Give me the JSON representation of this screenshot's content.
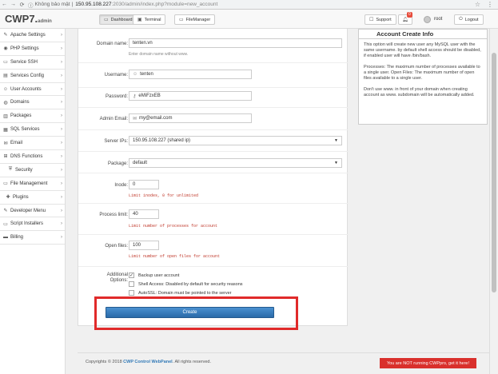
{
  "browser": {
    "secure_label": "Không bảo mật",
    "url_host": "150.95.108.227",
    "url_path": ":2030/admin/index.php?module=new_account"
  },
  "header": {
    "logo": "CWP7.",
    "logo_sub": "admin",
    "tabs": [
      {
        "label": "Dashboard",
        "icon": "monitor-icon"
      },
      {
        "label": "Terminal",
        "icon": "terminal-icon"
      },
      {
        "label": "FileManager",
        "icon": "folder-icon"
      }
    ],
    "support": "Support",
    "notifications": "0",
    "user": "root",
    "logout": "Logout"
  },
  "sidebar": {
    "items": [
      {
        "label": "Apache Settings",
        "icon": "wrench-icon"
      },
      {
        "label": "PHP Settings",
        "icon": "php-icon"
      },
      {
        "label": "Service SSH",
        "icon": "terminal-icon"
      },
      {
        "label": "Services Config",
        "icon": "server-icon"
      },
      {
        "label": "User Accounts",
        "icon": "user-icon"
      },
      {
        "label": "Domains",
        "icon": "globe-icon"
      },
      {
        "label": "Packages",
        "icon": "package-icon"
      },
      {
        "label": "SQL Services",
        "icon": "database-icon"
      },
      {
        "label": "Email",
        "icon": "envelope-icon"
      },
      {
        "label": "DNS Functions",
        "icon": "sitemap-icon"
      },
      {
        "label": "Security",
        "icon": "shield-icon"
      },
      {
        "label": "File Management",
        "icon": "folder-icon"
      },
      {
        "label": "Plugins",
        "icon": "puzzle-icon"
      },
      {
        "label": "Developer Menu",
        "icon": "code-icon"
      },
      {
        "label": "Script Installers",
        "icon": "download-icon"
      },
      {
        "label": "Billing",
        "icon": "credit-card-icon"
      }
    ]
  },
  "form": {
    "domain_label": "Domain name:",
    "domain_value": "tenten.vn",
    "domain_hint": "Enter domain name without www.",
    "username_label": "Username:",
    "username_value": "tenten",
    "password_label": "Password:",
    "password_value": "eMiFzxEB",
    "email_label": "Admin Email:",
    "email_value": "my@email.com",
    "ip_label": "Server IPs:",
    "ip_value": "150.95.108.227 (shared ip)",
    "package_label": "Package:",
    "package_value": "default",
    "inode_label": "Inode:",
    "inode_value": "0",
    "inode_hint": "Limit inodes, 0 for unlimited",
    "process_label": "Process limit:",
    "process_value": "40",
    "process_hint": "Limit number of processes for account",
    "openfiles_label": "Open files:",
    "openfiles_value": "100",
    "openfiles_hint": "Limit number of open files for account",
    "additional_label_1": "Additional",
    "additional_label_2": "Options:",
    "opt_backup": "Backup user account",
    "opt_backup_checked": "✓",
    "opt_shell": "Shell Access: Disabled by default for security reasons",
    "opt_autossl": "AutoSSL: Domain must be pointed to the server",
    "create_label": "Create"
  },
  "info": {
    "title": "Account Create Info",
    "p1": "This option will create new user any MySQL user with the same username. by default shell access should be disabled, if enabled user will have /bin/bash.",
    "p2": "Processes: The maximum number of processes available to a single user. Open Files: The maximum number of open files available to a single user.",
    "p3": "Don't use www. in front of your domain when creating account as www. subdomain will be automatically added."
  },
  "footer": {
    "copyright_prefix": "Copyrights © 2018 ",
    "copyright_brand": "CWP Control WebPanel",
    "copyright_suffix": ". All rights reserved.",
    "not_pro": "You are NOT running CWPpro, get it here!"
  },
  "colors": {
    "accent": "#337ab7",
    "highlight": "#e02a2a",
    "pro_banner": "#d9302c"
  }
}
